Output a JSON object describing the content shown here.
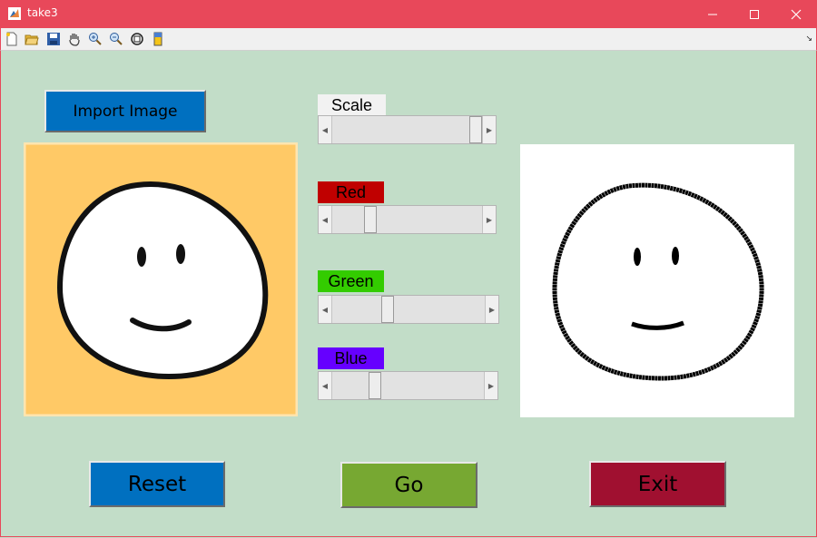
{
  "window": {
    "title": "take3",
    "minimize_icon": "minimize-icon",
    "maximize_icon": "maximize-icon",
    "close_icon": "close-icon"
  },
  "toolbar": {
    "icons": [
      "new-file-icon",
      "open-folder-icon",
      "save-icon",
      "pan-hand-icon",
      "zoom-in-icon",
      "zoom-out-icon",
      "rotate-3d-icon",
      "colorbar-icon"
    ]
  },
  "import_button": {
    "label": "Import Image",
    "color": "#0070c0"
  },
  "sliders": {
    "scale": {
      "label": "Scale",
      "label_color": "#f2f2f2",
      "value": 1.0
    },
    "red": {
      "label": "Red",
      "label_color": "#c00000",
      "value": 0.23
    },
    "green": {
      "label": "Green",
      "label_color": "#33cc00",
      "value": 0.35
    },
    "blue": {
      "label": "Blue",
      "label_color": "#6600ff",
      "value": 0.26
    }
  },
  "images": {
    "original": {
      "background": "#ffc966",
      "content": "smiley-face"
    },
    "processed": {
      "background": "#ffffff",
      "content": "smiley-face-edges"
    }
  },
  "buttons": {
    "reset": {
      "label": "Reset",
      "color": "#0070c0"
    },
    "go": {
      "label": "Go",
      "color": "#77a832"
    },
    "exit": {
      "label": "Exit",
      "color": "#a01030"
    }
  }
}
